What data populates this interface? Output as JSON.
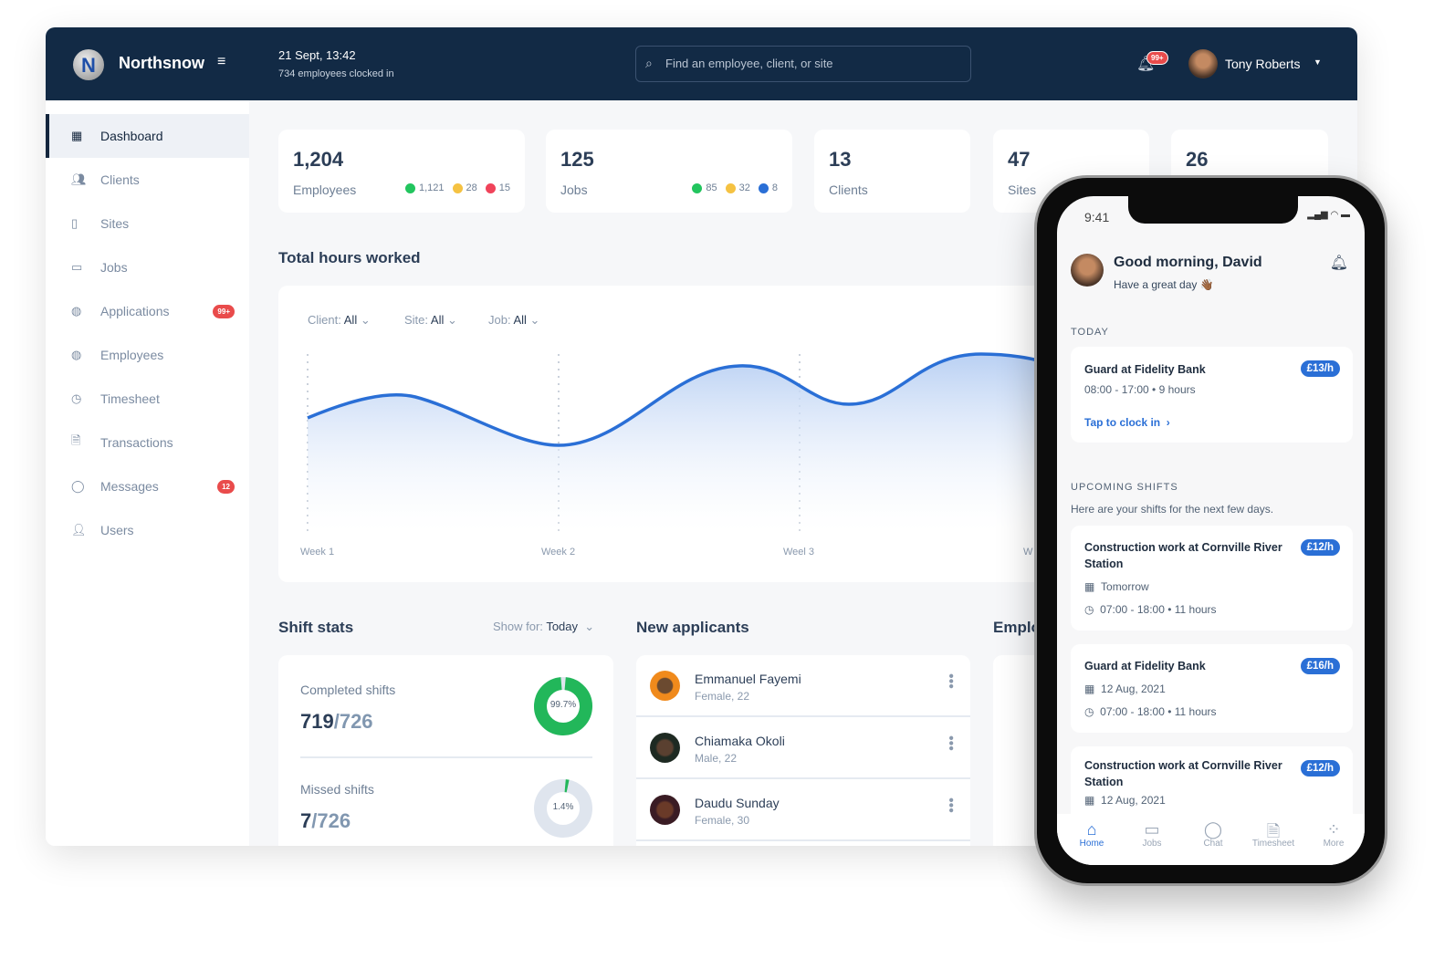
{
  "header": {
    "brand": "Northsnow",
    "date": "21 Sept, 13:42",
    "clocked_in": "734 employees clocked in",
    "search_placeholder": "Find an employee, client, or site",
    "notif_badge": "99+",
    "user_name": "Tony Roberts"
  },
  "sidebar": {
    "items": [
      {
        "label": "Dashboard",
        "icon": "grid-icon",
        "active": true
      },
      {
        "label": "Clients",
        "icon": "users-icon"
      },
      {
        "label": "Sites",
        "icon": "building-icon"
      },
      {
        "label": "Jobs",
        "icon": "briefcase-icon"
      },
      {
        "label": "Applications",
        "icon": "globe-icon",
        "badge": "99+"
      },
      {
        "label": "Employees",
        "icon": "globe-icon"
      },
      {
        "label": "Timesheet",
        "icon": "clock-icon"
      },
      {
        "label": "Transactions",
        "icon": "document-icon"
      },
      {
        "label": "Messages",
        "icon": "chat-icon",
        "badge": "12"
      },
      {
        "label": "Users",
        "icon": "user-icon"
      }
    ]
  },
  "stats": [
    {
      "value": "1,204",
      "label": "Employees",
      "counts": [
        "1,121",
        "28",
        "15"
      ]
    },
    {
      "value": "125",
      "label": "Jobs",
      "counts": [
        "85",
        "32",
        "8"
      ]
    },
    {
      "value": "13",
      "label": "Clients"
    },
    {
      "value": "47",
      "label": "Sites"
    },
    {
      "value": "26",
      "label": ""
    }
  ],
  "status_colors": {
    "green": "#22c55e",
    "yellow": "#f5c242",
    "red": "#f0435a",
    "blue": "#2a6fd6"
  },
  "hours": {
    "title": "Total hours worked",
    "filters": [
      {
        "label": "Client:",
        "value": "All"
      },
      {
        "label": "Site:",
        "value": "All"
      },
      {
        "label": "Job:",
        "value": "All"
      }
    ],
    "weeks": [
      "Week 1",
      "Week 2",
      "Weel 3",
      "W"
    ]
  },
  "shift_stats": {
    "title": "Shift stats",
    "show_for_label": "Show for:",
    "show_for_value": "Today",
    "completed": {
      "label": "Completed shifts",
      "done": "719",
      "total": "/726",
      "pct": "99.7%",
      "fraction": 0.997
    },
    "missed": {
      "label": "Missed shifts",
      "done": "7",
      "total": "/726",
      "pct": "1.4%",
      "fraction": 0.014
    }
  },
  "applicants": {
    "title": "New applicants",
    "items": [
      {
        "name": "Emmanuel Fayemi",
        "meta": "Female, 22"
      },
      {
        "name": "Chiamaka Okoli",
        "meta": "Male, 22"
      },
      {
        "name": "Daudu Sunday",
        "meta": "Female, 30"
      }
    ]
  },
  "employees_title": "Emplo",
  "phone": {
    "time": "9:41",
    "greeting": "Good morning, David",
    "subgreeting": "Have a great day 👋🏾",
    "today_label": "TODAY",
    "today": {
      "title": "Guard at Fidelity Bank",
      "rate": "£13/h",
      "time": "08:00 - 17:00 • 9 hours",
      "cta": "Tap to clock in"
    },
    "upcoming_label": "UPCOMING SHIFTS",
    "upcoming_sub": "Here are your shifts for the next few days.",
    "shifts": [
      {
        "title": "Construction work at Cornville River Station",
        "rate": "£12/h",
        "date": "Tomorrow",
        "time": "07:00 - 18:00 • 11 hours"
      },
      {
        "title": "Guard at Fidelity Bank",
        "rate": "£16/h",
        "date": "12 Aug, 2021",
        "time": "07:00 - 18:00 • 11 hours"
      },
      {
        "title": "Construction work at Cornville River Station",
        "rate": "£12/h",
        "date": "12 Aug, 2021"
      }
    ],
    "tabs": [
      "Home",
      "Jobs",
      "Chat",
      "Timesheet",
      "More"
    ]
  }
}
